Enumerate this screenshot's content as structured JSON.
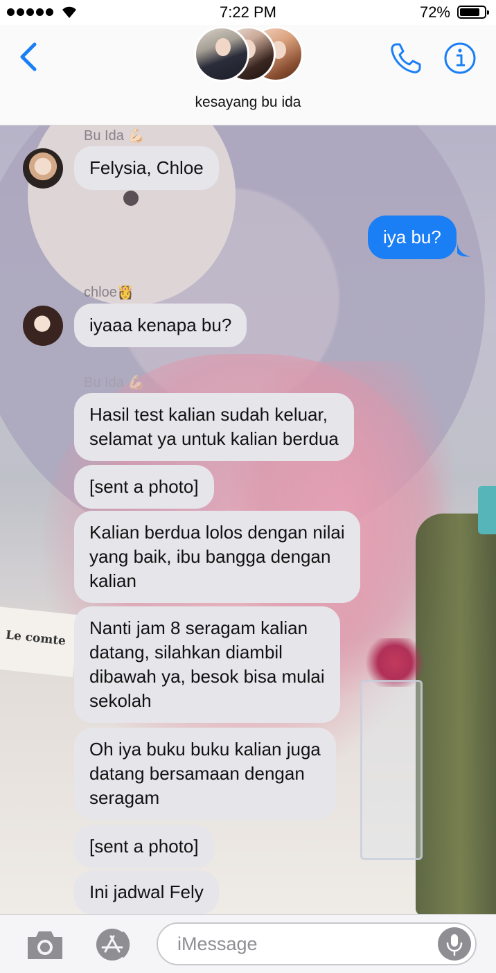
{
  "status_bar": {
    "time": "7:22 PM",
    "battery_percent": "72%",
    "battery_level": 0.72,
    "signal_bars": 5
  },
  "header": {
    "chat_name": "kesayang bu ida",
    "icons": [
      "back-chevron-icon",
      "phone-icon",
      "info-icon"
    ]
  },
  "conversation": {
    "sender_1": "Bu Ida 💪🏻",
    "msg_1": "Felysia, Chloe",
    "msg_2": "iya bu?",
    "sender_2": "chloe👸",
    "msg_3": "iyaaa kenapa bu?",
    "sender_3": "Bu Ida 💪🏻",
    "msg_4": "Hasil test kalian sudah keluar,\nselamat ya untuk kalian berdua",
    "msg_5": "[sent a photo]",
    "msg_6": "Kalian berdua lolos dengan nilai\nyang baik, ibu bangga dengan\nkalian",
    "msg_7": "Nanti jam 8 seragam kalian\ndatang, silahkan diambil\ndibawah ya, besok bisa mulai\nsekolah",
    "msg_8": "Oh iya buku buku kalian juga\ndatang bersamaan dengan\nseragam",
    "msg_9": "[sent a photo]",
    "msg_10": "Ini jadwal Fely",
    "background_text": "Le comte"
  },
  "input_bar": {
    "placeholder": "iMessage",
    "icons": [
      "camera-icon",
      "app-store-icon",
      "microphone-icon"
    ]
  },
  "colors": {
    "accent_blue": "#1a7ef5",
    "incoming_bubble": "#e6e5ea",
    "outgoing_text": "#ffffff"
  }
}
